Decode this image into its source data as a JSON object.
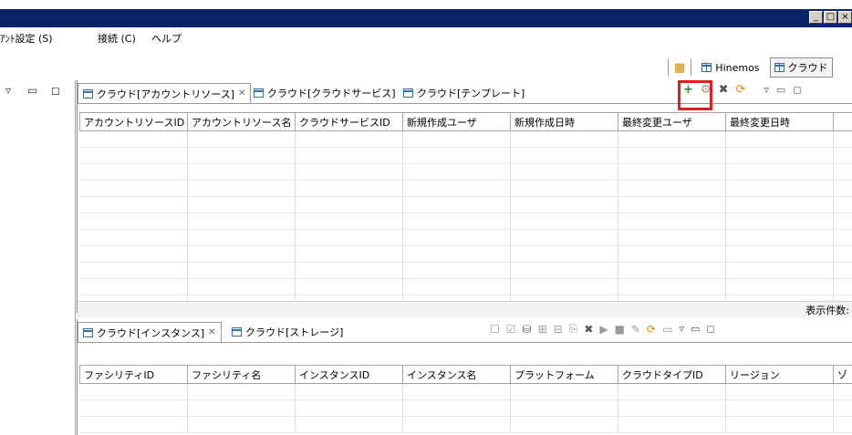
{
  "menu": {
    "items": [
      "ｱﾝﾄ設定 (S)",
      "接続 (C)",
      "ヘルプ"
    ]
  },
  "perspectives": {
    "items": [
      {
        "label": "Hinemos"
      },
      {
        "label": "クラウド"
      }
    ]
  },
  "top_view": {
    "tabs": [
      {
        "label": "クラウド[アカウントリソース]",
        "close": "✕"
      },
      {
        "label": "クラウド[クラウドサービス]"
      },
      {
        "label": "クラウド[テンプレート]"
      }
    ],
    "columns": [
      "アカウントリソースID",
      "アカウントリソース名",
      "クラウドサービスID",
      "新規作成ユーザ",
      "新規作成日時",
      "最終変更ユーザ",
      "最終変更日時"
    ],
    "status": "表示件数:"
  },
  "bottom_view": {
    "tabs": [
      {
        "label": "クラウド[インスタンス]",
        "close": "✕"
      },
      {
        "label": "クラウド[ストレージ]"
      }
    ],
    "columns": [
      "ファシリティID",
      "ファシリティ名",
      "インスタンスID",
      "インスタンス名",
      "プラットフォーム",
      "クラウドタイプID",
      "リージョン",
      "ゾ"
    ]
  },
  "colors": {
    "title_band": "#0a246a",
    "highlight": "#e02020",
    "add_green": "#2a8a2a"
  }
}
